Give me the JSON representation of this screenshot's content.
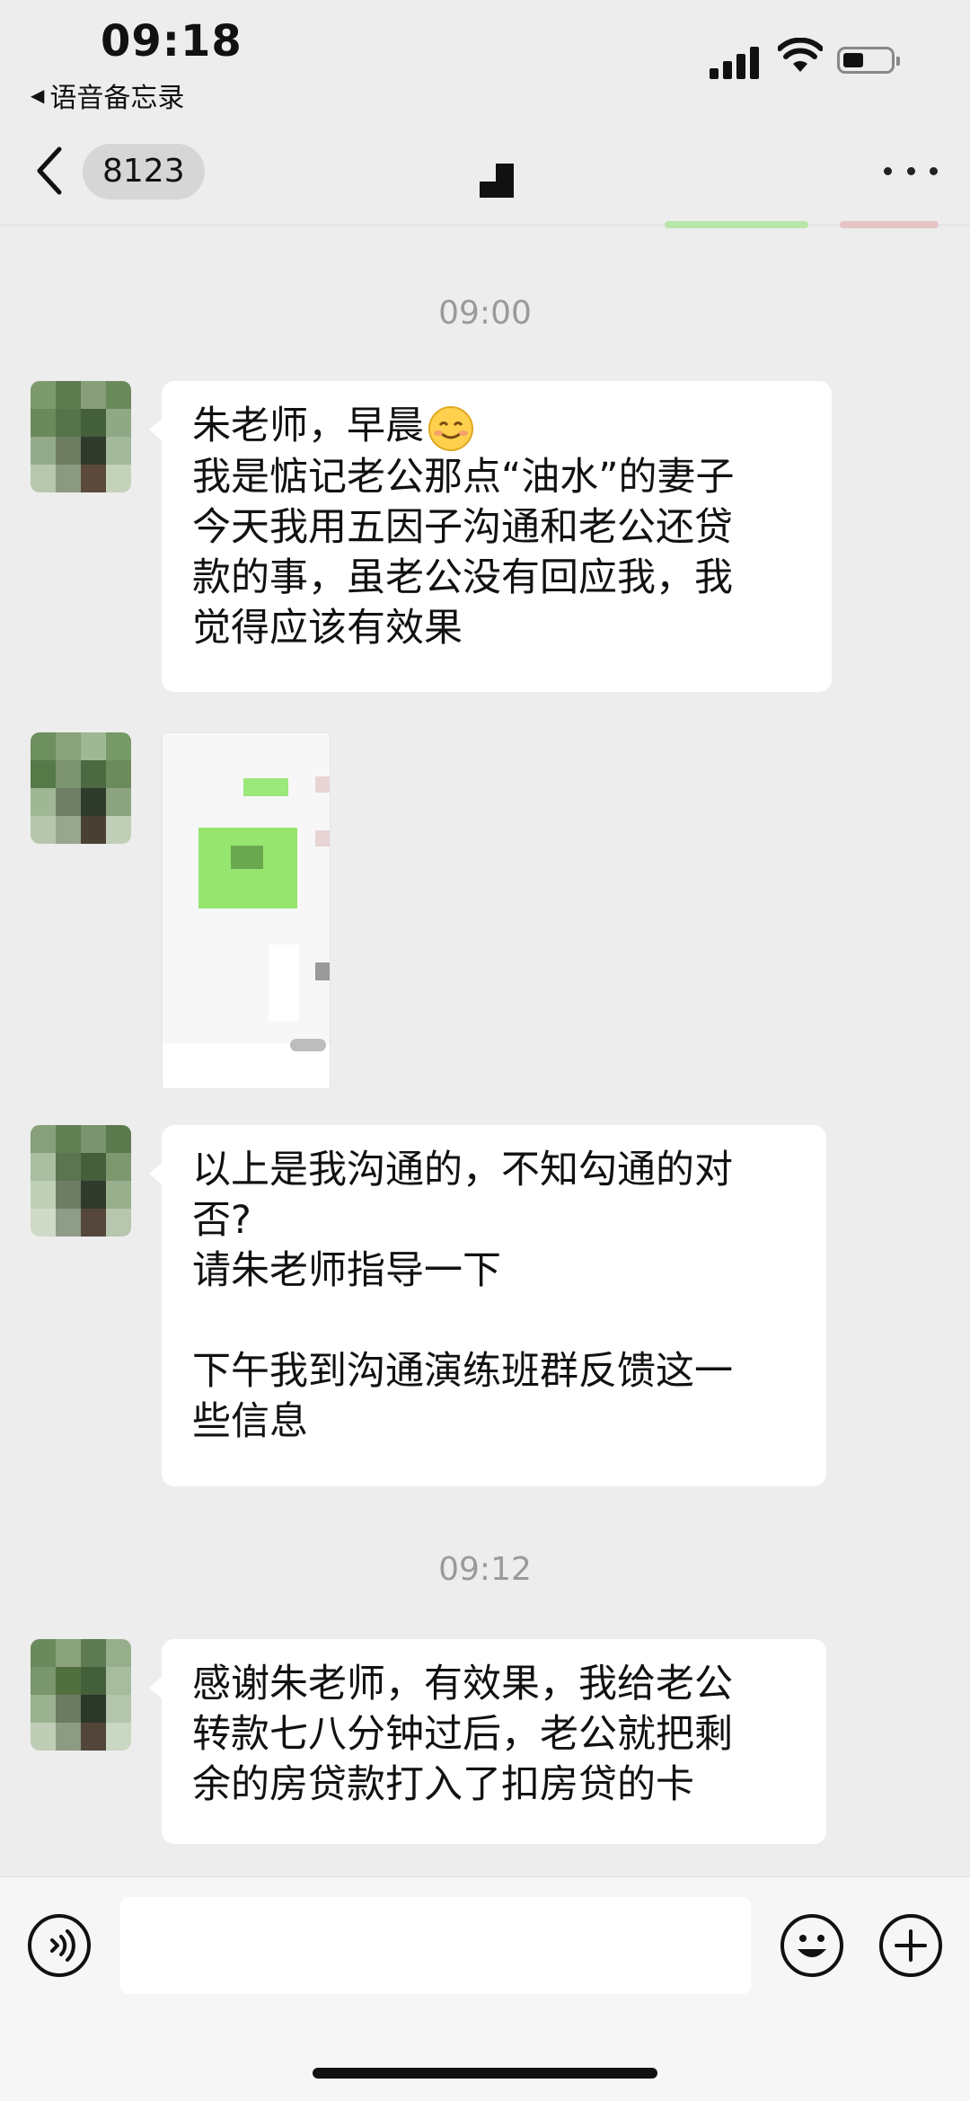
{
  "status_bar": {
    "time": "09:18",
    "back_app": "语音备忘录",
    "back_arrow": "◀"
  },
  "nav": {
    "unread_count": "8123"
  },
  "messages": [
    {
      "type": "timestamp",
      "text": "09:00"
    },
    {
      "type": "text",
      "lines": [
        "朱老师，早晨",
        "我是惦记老公那点“油水”的妻子",
        "今天我用五因子沟通和老公还贷",
        "款的事，虽老公没有回应我，我",
        "觉得应该有效果"
      ]
    },
    {
      "type": "image"
    },
    {
      "type": "text",
      "lines": [
        "以上是我沟通的，不知勾通的对",
        "否?",
        "请朱老师指导一下",
        "",
        "下午我到沟通演练班群反馈这一",
        "些信息"
      ]
    },
    {
      "type": "timestamp",
      "text": "09:12"
    },
    {
      "type": "text",
      "lines": [
        "感谢朱老师，有效果，我给老公",
        "转款七八分钟过后，老公就把剩",
        "余的房贷款打入了扣房贷的卡"
      ]
    }
  ],
  "colors": {
    "background": "#ededed",
    "bubble": "#ffffff",
    "timestamp": "#9a9a9a",
    "input_bar": "#f6f6f6"
  },
  "icons": {
    "status": [
      "signal-icon",
      "wifi-icon",
      "battery-icon"
    ],
    "nav": [
      "back-chevron-icon",
      "title-avatar-icon",
      "more-icon"
    ],
    "input": [
      "voice-icon",
      "emoji-icon",
      "plus-icon"
    ]
  }
}
